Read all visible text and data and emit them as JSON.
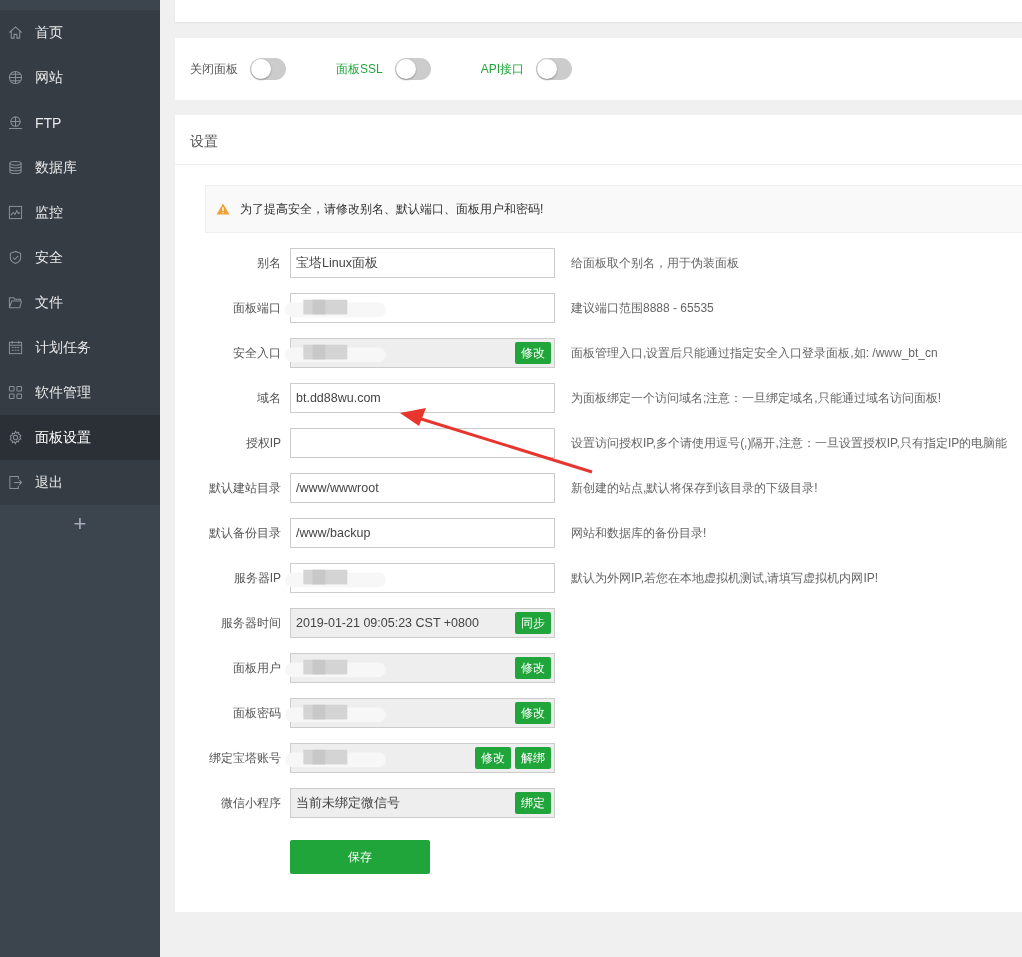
{
  "sidebar": {
    "items": [
      {
        "label": "首页",
        "selected": false
      },
      {
        "label": "网站",
        "selected": false
      },
      {
        "label": "FTP",
        "selected": false
      },
      {
        "label": "数据库",
        "selected": false
      },
      {
        "label": "监控",
        "selected": false
      },
      {
        "label": "安全",
        "selected": false
      },
      {
        "label": "文件",
        "selected": false
      },
      {
        "label": "计划任务",
        "selected": false
      },
      {
        "label": "软件管理",
        "selected": false
      },
      {
        "label": "面板设置",
        "selected": true
      },
      {
        "label": "退出",
        "selected": false
      }
    ],
    "add_button": "+"
  },
  "toggles": [
    {
      "label": "关闭面板",
      "color": "#555555",
      "on": false
    },
    {
      "label": "面板SSL",
      "color": "#20a53a",
      "on": false
    },
    {
      "label": "API接口",
      "color": "#20a53a",
      "on": false
    }
  ],
  "settings": {
    "title": "设置",
    "alert": "为了提高安全，请修改别名、默认端口、面板用户和密码!",
    "rows": [
      {
        "label": "别名",
        "kind": "text",
        "value": "宝塔Linux面板",
        "redacted": false,
        "buttons": [],
        "hint": "给面板取个别名，用于伪装面板"
      },
      {
        "label": "面板端口",
        "kind": "text",
        "redacted": true,
        "buttons": [],
        "hint": "建议端口范围8888 - 65535"
      },
      {
        "label": "安全入口",
        "kind": "readonly",
        "redacted": true,
        "buttons": [
          "修改"
        ],
        "hint": "面板管理入口,设置后只能通过指定安全入口登录面板,如: /www_bt_cn"
      },
      {
        "label": "域名",
        "kind": "text",
        "value": "bt.dd88wu.com",
        "redacted": false,
        "buttons": [],
        "hint": "为面板绑定一个访问域名;注意：一旦绑定域名,只能通过域名访问面板!"
      },
      {
        "label": "授权IP",
        "kind": "text",
        "redacted": false,
        "buttons": [],
        "hint": "设置访问授权IP,多个请使用逗号(,)隔开,注意：一旦设置授权IP,只有指定IP的电脑能"
      },
      {
        "label": "默认建站目录",
        "kind": "text",
        "value": "/www/wwwroot",
        "redacted": false,
        "buttons": [],
        "hint": "新创建的站点,默认将保存到该目录的下级目录!"
      },
      {
        "label": "默认备份目录",
        "kind": "text",
        "value": "/www/backup",
        "redacted": false,
        "buttons": [],
        "hint": "网站和数据库的备份目录!"
      },
      {
        "label": "服务器IP",
        "kind": "text",
        "redacted": true,
        "buttons": [],
        "hint": "默认为外网IP,若您在本地虚拟机测试,请填写虚拟机内网IP!"
      },
      {
        "label": "服务器时间",
        "kind": "readonly",
        "value": "2019-01-21 09:05:23 CST +0800",
        "redacted": false,
        "buttons": [
          "同步"
        ]
      },
      {
        "label": "面板用户",
        "kind": "readonly",
        "redacted": true,
        "buttons": [
          "修改"
        ]
      },
      {
        "label": "面板密码",
        "kind": "readonly",
        "redacted": true,
        "buttons": [
          "修改"
        ]
      },
      {
        "label": "绑定宝塔账号",
        "kind": "readonly",
        "redacted": true,
        "buttons": [
          "修改",
          "解绑"
        ]
      },
      {
        "label": "微信小程序",
        "kind": "readonly",
        "value": "当前未绑定微信号",
        "redacted": false,
        "buttons": [
          "绑定"
        ]
      }
    ],
    "save_button": "保存"
  }
}
